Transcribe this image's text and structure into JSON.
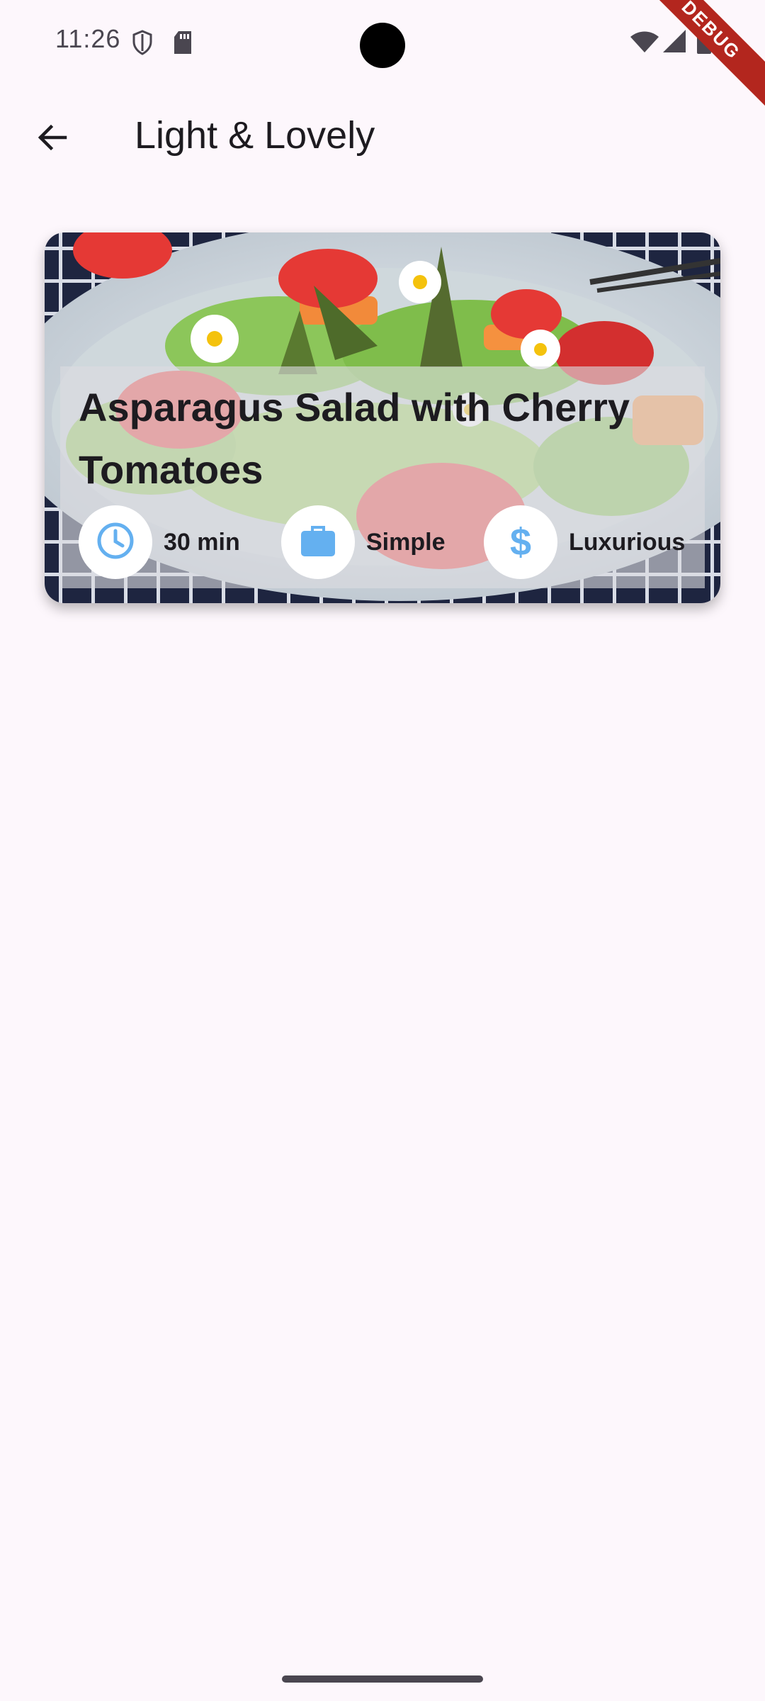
{
  "status_bar": {
    "time": "11:26",
    "debug_label": "DEBUG"
  },
  "app_bar": {
    "title": "Light & Lovely",
    "back_icon": "arrow-back-icon"
  },
  "meal": {
    "title": "Asparagus Salad with Cherry Tomatoes",
    "duration": "30 min",
    "complexity": "Simple",
    "affordability": "Luxurious",
    "icons": {
      "duration": "clock-icon",
      "complexity": "briefcase-icon",
      "affordability": "dollar-icon"
    }
  },
  "colors": {
    "background": "#fdf7fc",
    "icon_accent": "#64b0f0",
    "debug_ribbon": "#b3261e"
  }
}
